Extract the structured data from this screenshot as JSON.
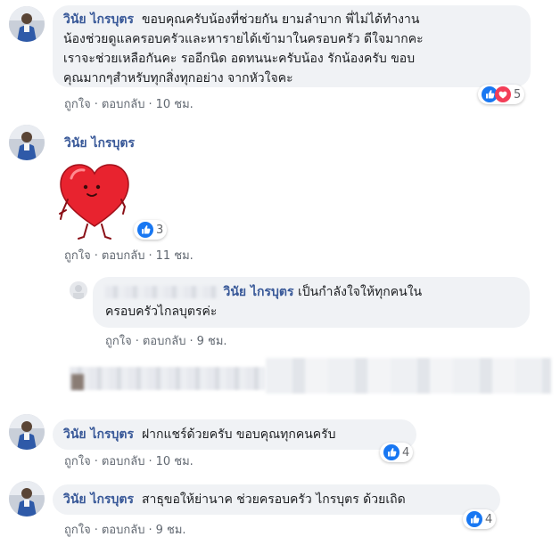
{
  "comments": [
    {
      "author": "วินัย ไกรบุตร",
      "lines": [
        "ขอบคุณครับน้องที่ช่วยกัน ยามลำบาก พี่ไม่ได้ทำงาน",
        "น้องช่วยดูแลครอบครัวและหารายได้เข้ามาในครอบครัว ดีใจมากคะ",
        "เราจะช่วยเหลือกันคะ รออีกนิด อดทนนะครับน้อง รักน้องครับ ขอบ",
        "คุณมากๆสำหรับทุกสิ่งทุกอย่าง จากหัวใจคะ"
      ],
      "reactions": {
        "count": "5",
        "icons": [
          "like-icon",
          "love-icon"
        ]
      },
      "like_label": "ถูกใจ",
      "reply_label": "ตอบกลับ",
      "time": "10 ชม."
    },
    {
      "author": "วินัย ไกรบุตร",
      "sticker": "heart-sticker",
      "reactions": {
        "count": "3",
        "icons": [
          "like-icon"
        ]
      },
      "like_label": "ถูกใจ",
      "reply_label": "ตอบกลับ",
      "time": "11 ชม."
    },
    {
      "author": "วินัย ไกรบุตร",
      "reply_line1": "เป็นกำลังใจให้ทุกคนใน",
      "reply_line2": "ครอบครัวไกลบุตรค่ะ",
      "like_label": "ถูกใจ",
      "reply_label": "ตอบกลับ",
      "time": "9 ชม."
    },
    {
      "author": "วินัย ไกรบุตร",
      "text": "ฝากแชร์ด้วยครับ ขอบคุณทุกคนครับ",
      "reactions": {
        "count": "4",
        "icons": [
          "like-icon"
        ]
      },
      "like_label": "ถูกใจ",
      "reply_label": "ตอบกลับ",
      "time": "10 ชม."
    },
    {
      "author": "วินัย ไกรบุตร",
      "text": "สาธุขอให้ย่านาค ช่วยครอบครัว ไกรบุตร ด้วยเถิด",
      "reactions": {
        "count": "4",
        "icons": [
          "like-icon"
        ]
      },
      "like_label": "ถูกใจ",
      "reply_label": "ตอบกลับ",
      "time": "9 ชม."
    }
  ],
  "colors": {
    "author": "#385898",
    "bubble": "#f0f2f5",
    "like": "#1877f2",
    "love": "#f33e58",
    "meta": "#606770"
  }
}
